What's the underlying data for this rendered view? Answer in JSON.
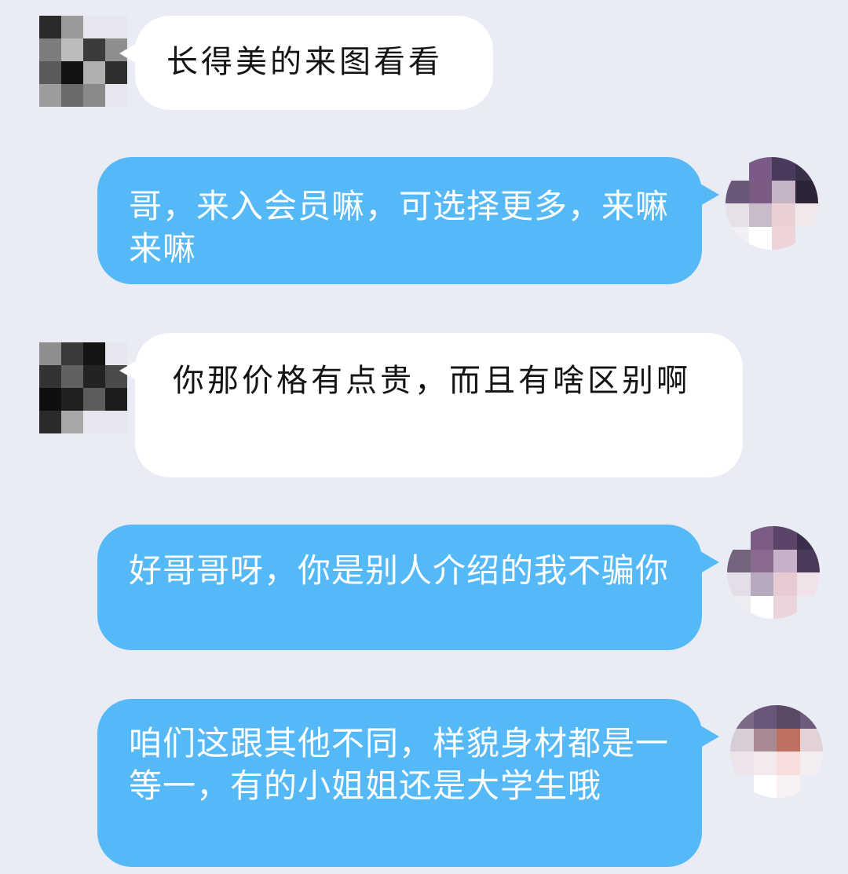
{
  "messages": [
    {
      "side": "received",
      "text": "长得美的来图看看",
      "avatar": "blurred-user-avatar"
    },
    {
      "side": "sent",
      "text": "哥，来入会员嘛，可选择更多，来嘛来嘛",
      "avatar": "blurred-contact-avatar"
    },
    {
      "side": "received",
      "text": "你那价格有点贵，而且有啥区别啊",
      "avatar": "blurred-user-avatar"
    },
    {
      "side": "sent",
      "text": "好哥哥呀，你是别人介绍的我不骗你",
      "avatar": "blurred-contact-avatar"
    },
    {
      "side": "sent",
      "text": "咱们这跟其他不同，样貌身材都是一等一，有的小姐姐还是大学生哦",
      "avatar": "blurred-contact-avatar"
    }
  ],
  "colors": {
    "background": "#e9ebf5",
    "received_bubble": "#ffffff",
    "sent_bubble": "#55b9f8",
    "sent_text": "#ffffff",
    "received_text": "#141414"
  }
}
